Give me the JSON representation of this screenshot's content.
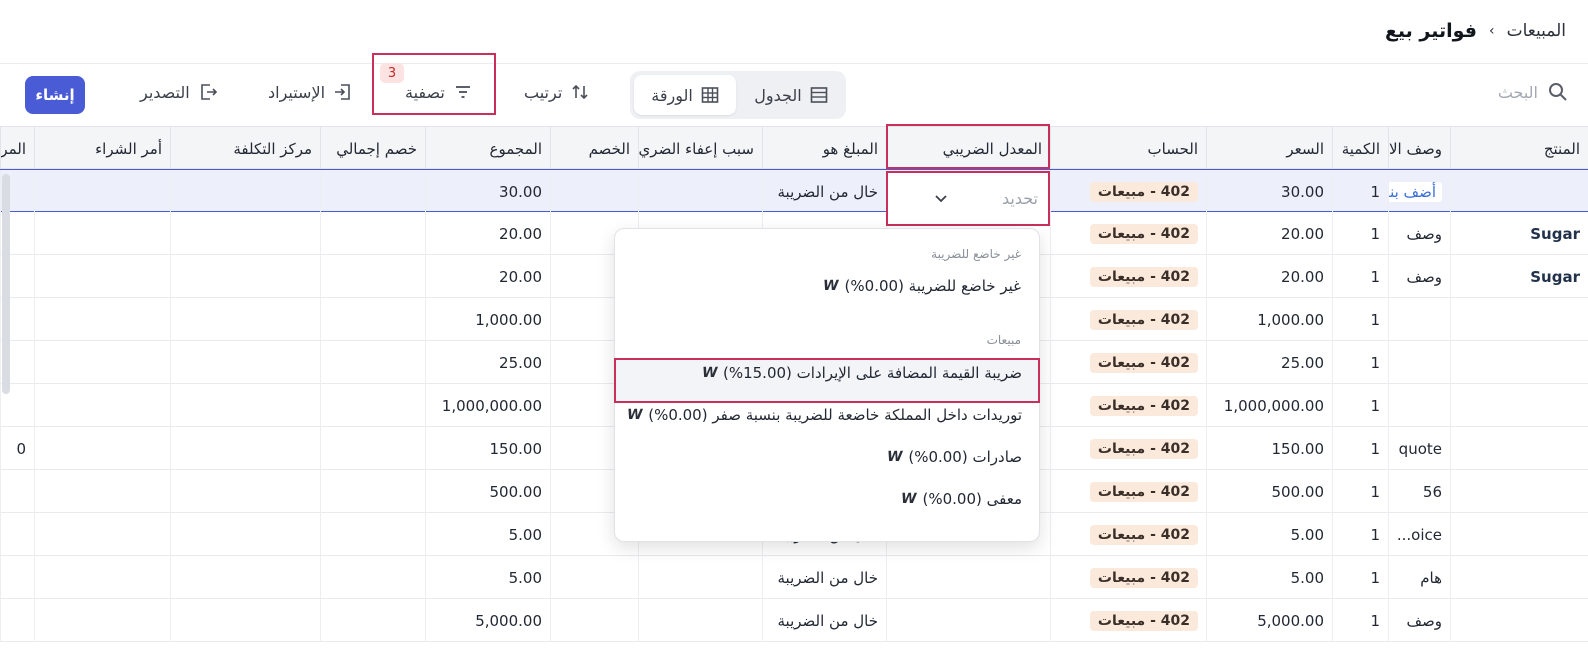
{
  "breadcrumb": {
    "root": "المبيعات",
    "separator": "›",
    "current": "فواتير بيع"
  },
  "toolbar": {
    "search_placeholder": "البحث",
    "view_table": "الجدول",
    "view_sheet": "الورقة",
    "sort": "ترتيب",
    "filter": "تصفية",
    "filter_count": "3",
    "import": "الإستيراد",
    "export": "التصدير",
    "create": "إنشاء"
  },
  "columns": {
    "product": "المنتج",
    "description": "وصف الا",
    "quantity": "الكمية",
    "price": "السعر",
    "account": "الحساب",
    "tax_rate": "المعدل الضريبي",
    "amount_is": "المبلغ هو",
    "exemption": "سبب إعفاء الضري",
    "discount": "الخصم",
    "total": "المجموع",
    "global_discount": "خصم إجمالي",
    "cost_center": "مركز التكلفة",
    "purchase_order": "أمر الشراء",
    "more": "المر"
  },
  "rows": [
    {
      "product": "",
      "description": "أضف بند",
      "qty": "1",
      "price": "30.00",
      "account": "402 - مبيعات",
      "amount_is": "خال من الضريبة",
      "total": "30.00",
      "more": ""
    },
    {
      "product": "Sugar",
      "description": "وصف",
      "qty": "1",
      "price": "20.00",
      "account": "402 - مبيعات",
      "amount_is": "",
      "total": "20.00",
      "more": ""
    },
    {
      "product": "Sugar",
      "description": "وصف",
      "qty": "1",
      "price": "20.00",
      "account": "402 - مبيعات",
      "amount_is": "",
      "total": "20.00",
      "more": ""
    },
    {
      "product": "",
      "description": "",
      "qty": "1",
      "price": "1,000.00",
      "account": "402 - مبيعات",
      "amount_is": "",
      "total": "1,000.00",
      "more": ""
    },
    {
      "product": "",
      "description": "",
      "qty": "1",
      "price": "25.00",
      "account": "402 - مبيعات",
      "amount_is": "",
      "total": "25.00",
      "more": ""
    },
    {
      "product": "",
      "description": "",
      "qty": "1",
      "price": "1,000,000.00",
      "account": "402 - مبيعات",
      "amount_is": "",
      "total": "1,000,000.00",
      "more": ""
    },
    {
      "product": "",
      "description": "quote",
      "qty": "1",
      "price": "150.00",
      "account": "402 - مبيعات",
      "amount_is": "",
      "total": "150.00",
      "more": "0"
    },
    {
      "product": "",
      "description": "56",
      "qty": "1",
      "price": "500.00",
      "account": "402 - مبيعات",
      "amount_is": "",
      "total": "500.00",
      "more": ""
    },
    {
      "product": "",
      "description": "oice...",
      "qty": "1",
      "price": "5.00",
      "account": "402 - مبيعات",
      "amount_is": "خال من الضريبة",
      "total": "5.00",
      "more": ""
    },
    {
      "product": "",
      "description": "هام",
      "qty": "1",
      "price": "5.00",
      "account": "402 - مبيعات",
      "amount_is": "خال من الضريبة",
      "total": "5.00",
      "more": ""
    },
    {
      "product": "",
      "description": "وصف",
      "qty": "1",
      "price": "5,000.00",
      "account": "402 - مبيعات",
      "amount_is": "خال من الضريبة",
      "total": "5,000.00",
      "more": ""
    }
  ],
  "tax_input": {
    "placeholder": "تحديد"
  },
  "dropdown": {
    "group_non_taxable": "غير خاضع للضريبة",
    "opt_non_taxable": "غير خاضع للضريبة (0.00%)",
    "group_sales": "مبيعات",
    "opt_vat": "ضريبة القيمة المضافة على الإيرادات (15.00%)",
    "opt_domestic_zero": "توريدات داخل المملكة خاضعة للضريبة بنسبة صفر (0.00%)",
    "opt_exports": "صادرات (0.00%)",
    "opt_exempt": "معفى (0.00%)",
    "icon_char": "W"
  },
  "colors": {
    "accent": "#4a5bd6",
    "highlight_border": "#c7305a",
    "tag_bg": "#fbe9dc"
  }
}
